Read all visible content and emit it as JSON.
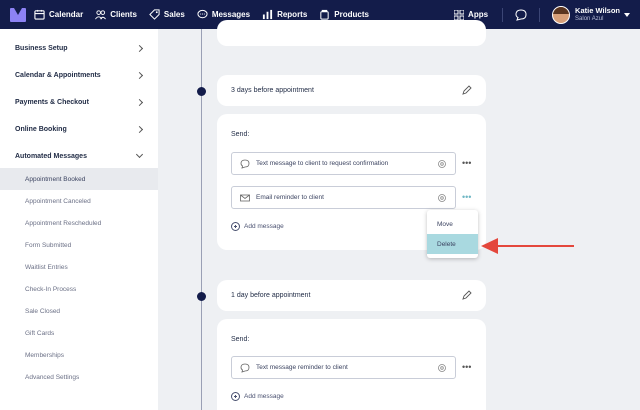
{
  "nav": {
    "items": [
      {
        "label": "Calendar",
        "icon": "calendar-icon"
      },
      {
        "label": "Clients",
        "icon": "people-icon"
      },
      {
        "label": "Sales",
        "icon": "tag-icon"
      },
      {
        "label": "Messages",
        "icon": "chat-icon"
      },
      {
        "label": "Reports",
        "icon": "bar-chart-icon"
      },
      {
        "label": "Products",
        "icon": "jar-icon"
      }
    ],
    "apps_label": "Apps",
    "user_name": "Katie Wilson",
    "salon_name": "Salon Azul"
  },
  "sidebar": {
    "sections": [
      "Business Setup",
      "Calendar & Appointments",
      "Payments & Checkout",
      "Online Booking",
      "Automated Messages"
    ],
    "sub_items": [
      "Appointment Booked",
      "Appointment Canceled",
      "Appointment Rescheduled",
      "Form Submitted",
      "Waitlist Entries",
      "Check-In Process",
      "Sale Closed",
      "Gift Cards",
      "Memberships",
      "Advanced Settings"
    ],
    "active_sub": "Appointment Booked"
  },
  "steps": [
    {
      "title": "3 days before appointment",
      "send_label": "Send:",
      "messages": [
        "Text message to client to request confirmation",
        "Email reminder to client"
      ],
      "add_label": "Add message"
    },
    {
      "title": "1 day before appointment",
      "send_label": "Send:",
      "messages": [
        "Text message reminder to client"
      ],
      "add_label": "Add message"
    }
  ],
  "menu": {
    "items": [
      "Move",
      "Delete"
    ],
    "highlighted": "Delete"
  },
  "colors": {
    "nav_bg": "#131c4a",
    "menu_highlight": "#a9d9e0",
    "arrow": "#e4473c"
  }
}
